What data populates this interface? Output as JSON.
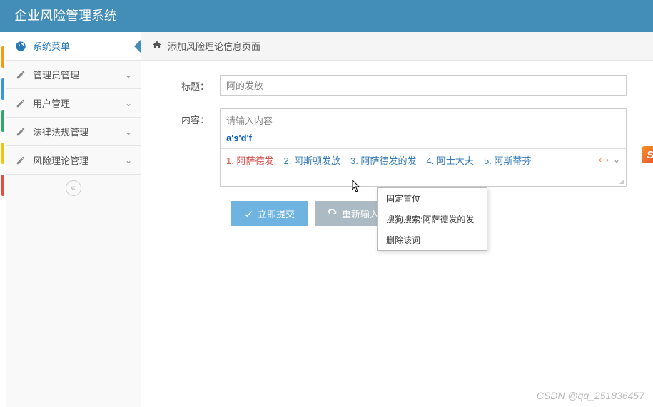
{
  "header": {
    "title": "企业风险管理系统"
  },
  "sidebar": {
    "items": [
      {
        "label": "系统菜单",
        "icon": "dashboard-icon",
        "active": true
      },
      {
        "label": "管理员管理",
        "icon": "edit-icon"
      },
      {
        "label": "用户管理",
        "icon": "edit-icon"
      },
      {
        "label": "法律法规管理",
        "icon": "edit-icon"
      },
      {
        "label": "风险理论管理",
        "icon": "edit-icon"
      }
    ],
    "collapse_icon": "«"
  },
  "breadcrumb": {
    "text": "添加风险理论信息页面"
  },
  "form": {
    "title_label": "标题：",
    "title_value": "阿的发放",
    "content_label": "内容：",
    "content_placeholder": "请输入内容",
    "ime_input": "a's'd'f"
  },
  "ime": {
    "candidates": [
      {
        "num": "1.",
        "text": "阿萨德发"
      },
      {
        "num": "2.",
        "text": "阿斯顿发放"
      },
      {
        "num": "3.",
        "text": "阿萨德发的发"
      },
      {
        "num": "4.",
        "text": "阿士大夫"
      },
      {
        "num": "5.",
        "text": "阿斯蒂芬"
      }
    ],
    "logo": "S"
  },
  "context_menu": {
    "items": [
      "固定首位",
      "搜狗搜索:阿萨德发的发",
      "删除该词"
    ]
  },
  "buttons": {
    "submit": "立即提交",
    "reset": "重新输入"
  },
  "watermark": "CSDN @qq_251836457"
}
